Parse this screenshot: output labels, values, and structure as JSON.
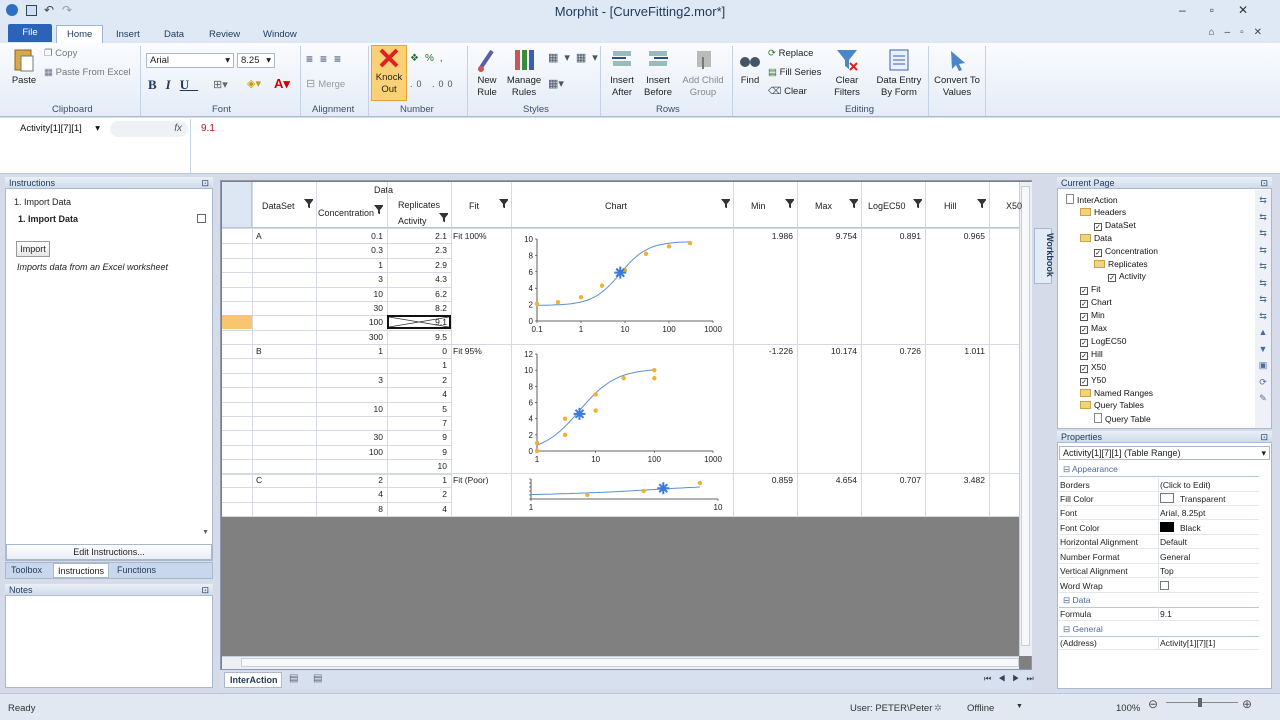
{
  "app": {
    "title": "Morphit - [CurveFitting2.mor*]"
  },
  "ribbon": {
    "tabs": [
      "File",
      "Home",
      "Insert",
      "Data",
      "Review",
      "Window"
    ],
    "clipboard": {
      "paste": "Paste",
      "copy": "Copy",
      "paste_excel": "Paste From Excel",
      "label": "Clipboard"
    },
    "font": {
      "family": "Arial",
      "size": "8.25",
      "label": "Font"
    },
    "alignment": {
      "merge": "Merge",
      "label": "Alignment"
    },
    "number": {
      "knock_out": "Knock Out",
      "label": "Number"
    },
    "styles": {
      "new_rule": "New Rule",
      "manage_rules": "Manage Rules",
      "label": "Styles"
    },
    "rows": {
      "insert_after": "Insert After",
      "insert_before": "Insert Before",
      "add_child": "Add Child Group",
      "label": "Rows"
    },
    "editing": {
      "find": "Find",
      "replace": "Replace",
      "fill_series": "Fill Series",
      "clear": "Clear",
      "clear_filters": "Clear Filters",
      "data_entry": "Data Entry By Form",
      "label": "Editing"
    },
    "convert": {
      "label": "Convert To Values"
    }
  },
  "formula_bar": {
    "name": "Activity[1][7][1]",
    "fx": "fx",
    "value": "9.1"
  },
  "instructions": {
    "header": "Instructions",
    "items": [
      "1. Import Data",
      "1. Import Data"
    ],
    "button": "Import",
    "description": "Imports data from an Excel worksheet",
    "edit": "Edit Instructions...",
    "tabs": [
      "Toolbox",
      "Instructions",
      "Functions"
    ],
    "notes": "Notes"
  },
  "grid": {
    "headers": {
      "dataset": "DataSet",
      "data": "Data",
      "concentration": "Concentration",
      "replicates": "Replicates",
      "activity": "Activity",
      "fit": "Fit",
      "chart": "Chart",
      "min": "Min",
      "max": "Max",
      "logec50": "LogEC50",
      "hill": "Hill",
      "x50": "X50"
    },
    "groups": [
      {
        "name": "A",
        "fit": "Fit 100%",
        "min": "1.986",
        "max": "9.754",
        "logec50": "0.891",
        "hill": "0.965",
        "rows": [
          [
            "0.1",
            "2.1"
          ],
          [
            "0.3",
            "2.3"
          ],
          [
            "1",
            "2.9"
          ],
          [
            "3",
            "4.3"
          ],
          [
            "10",
            "6.2"
          ],
          [
            "30",
            "8.2"
          ],
          [
            "100",
            "9.1"
          ],
          [
            "300",
            "9.5"
          ]
        ]
      },
      {
        "name": "B",
        "fit": "Fit 95%",
        "min": "-1.226",
        "max": "10.174",
        "logec50": "0.726",
        "hill": "1.011",
        "rows": [
          [
            "1",
            "0"
          ],
          [
            "",
            "1"
          ],
          [
            "3",
            "2"
          ],
          [
            "",
            "4"
          ],
          [
            "10",
            "5"
          ],
          [
            "",
            "7"
          ],
          [
            "30",
            "9"
          ],
          [
            "100",
            "9"
          ],
          [
            "",
            "10"
          ]
        ]
      },
      {
        "name": "C",
        "fit": "Fit (Poor)",
        "min": "0.859",
        "max": "4.654",
        "logec50": "0.707",
        "hill": "3.482",
        "rows": [
          [
            "2",
            "1"
          ],
          [
            "4",
            "2"
          ],
          [
            "8",
            "4"
          ]
        ]
      }
    ],
    "sheet_tab": "InterAction",
    "side_tab": "Workbook"
  },
  "chart_data": [
    {
      "type": "scatter",
      "x": [
        0.1,
        0.3,
        1,
        3,
        10,
        30,
        100,
        300
      ],
      "y": [
        2.1,
        2.3,
        2.9,
        4.3,
        6.2,
        8.2,
        9.1,
        9.5
      ],
      "ylim": [
        0,
        10
      ],
      "xscale": "log",
      "xticks": [
        "0.1",
        "1",
        "10",
        "100",
        "1000"
      ],
      "yticks": [
        "0",
        "2",
        "4",
        "6",
        "8",
        "10"
      ],
      "marker": {
        "x": 7.8,
        "y": 5.9
      }
    },
    {
      "type": "scatter",
      "x": [
        1,
        1,
        3,
        3,
        10,
        10,
        30,
        100,
        100
      ],
      "y": [
        0,
        1,
        2,
        4,
        5,
        7,
        9,
        9,
        10
      ],
      "ylim": [
        0,
        12
      ],
      "xscale": "log",
      "xticks": [
        "1",
        "10",
        "100",
        "1000"
      ],
      "yticks": [
        "0",
        "2",
        "4",
        "6",
        "8",
        "10",
        "12"
      ],
      "marker": {
        "x": 5.3,
        "y": 4.6
      }
    },
    {
      "type": "scatter",
      "x": [
        2,
        4,
        8
      ],
      "y": [
        1,
        2,
        4
      ],
      "ylim": [
        0,
        5
      ],
      "xscale": "log",
      "xticks": [
        "1",
        "10"
      ],
      "yticks": [
        "0",
        "1",
        "2",
        "3",
        "4",
        "5"
      ],
      "marker": {
        "x": 5.1,
        "y": 2.7
      }
    }
  ],
  "current_page": {
    "header": "Current Page",
    "tree": [
      "InterAction",
      "Headers",
      "DataSet",
      "Data",
      "Concentration",
      "Replicates",
      "Activity",
      "Fit",
      "Chart",
      "Min",
      "Max",
      "LogEC50",
      "Hill",
      "X50",
      "Y50",
      "Named Ranges",
      "Query Tables",
      "Query Table"
    ]
  },
  "properties": {
    "header": "Properties",
    "selected": "Activity[1][7][1] (Table Range)",
    "sections": [
      "Appearance",
      "Data",
      "General"
    ],
    "rows": [
      [
        "Borders",
        "(Click to Edit)"
      ],
      [
        "Fill Color",
        "Transparent"
      ],
      [
        "Font",
        "Arial, 8.25pt"
      ],
      [
        "Font Color",
        "Black"
      ],
      [
        "Horizontal Alignment",
        "Default"
      ],
      [
        "Number Format",
        "General"
      ],
      [
        "Vertical Alignment",
        "Top"
      ],
      [
        "Word Wrap",
        ""
      ],
      [
        "Formula",
        "9.1"
      ],
      [
        "(Address)",
        "Activity[1][7][1]"
      ]
    ]
  },
  "status": {
    "ready": "Ready",
    "user": "User: PETER\\Peter",
    "mode": "Offline",
    "zoom": "100%"
  }
}
